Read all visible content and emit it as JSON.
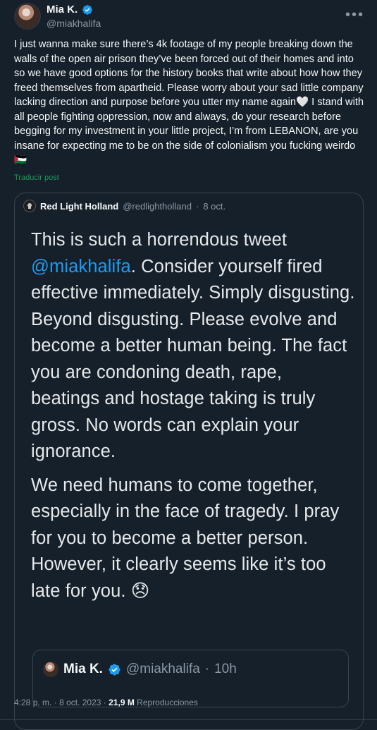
{
  "author": {
    "name": "Mia K.",
    "handle": "@miakhalifa",
    "verified": true
  },
  "tweet": {
    "text_part1": "I just wanna make sure there’s 4k footage of my people breaking down the walls of the open air prison they’ve been forced out of their homes and into so we have good options for the history books that write about how how they freed themselves from apartheid. Please worry about your sad little company lacking direction and purpose before you utter my name again",
    "emoji_heart": "🤍",
    "text_part2": " I stand with all people fighting oppression, now and always, do your research before begging for my investment in your little project, I’m from LEBANON, are you insane for expecting me to be on the side of colonialism you fucking weirdo",
    "emoji_flag": "🇵🇸",
    "translate_label": "Traducir post"
  },
  "quote": {
    "name": "Red Light Holland",
    "handle": "@redlightholland",
    "separator": "·",
    "date": "8 oct.",
    "body_pre": "This is such a horrendous tweet ",
    "mention": "@miakhalifa",
    "body_post": ". Consider yourself fired effective immediately. Simply disgusting. Beyond disgusting. Please evolve and become a better human being. The fact you are condoning death, rape, beatings and hostage taking is truly gross. No words can explain your ignorance.",
    "body_second": "We need humans to come together, especially in the face of tragedy. I pray for you to become a better person. However, it clearly seems like it’s too late for you.",
    "emoji_sad": "😞",
    "inner": {
      "name": "Mia K.",
      "handle": "@miakhalifa",
      "separator": "·",
      "time": "10h"
    }
  },
  "meta": {
    "time": "4:28 p. m.",
    "separator": "·",
    "date": "8 oct. 2023",
    "views_count": "21,9 M",
    "views_label": "Reproducciones"
  },
  "colors": {
    "background": "#15202b",
    "accent_blue": "#1d9bf0",
    "translate_green": "#1d9b5a",
    "muted": "#8b98a5"
  },
  "icons": {
    "verified": "verified-badge-icon",
    "more": "more-icon"
  }
}
